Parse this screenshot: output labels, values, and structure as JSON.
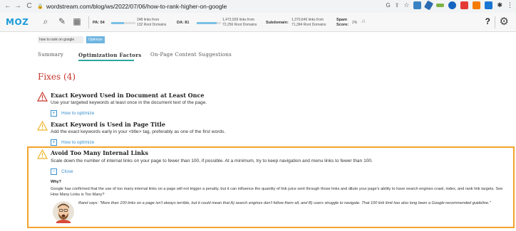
{
  "browser": {
    "url": "wordstream.com/blog/ws/2022/07/06/how-to-rank-higher-on-google",
    "icons": [
      "back-icon",
      "forward-icon",
      "reload-icon",
      "lock-icon",
      "google-icon",
      "share-icon",
      "star-icon"
    ]
  },
  "mozbar": {
    "logo": "MOZ",
    "pa_label": "PA: 54",
    "pa_score": 54,
    "pa_links_line1": "248 links from",
    "pa_links_line2": "132 Root Domains",
    "da_label": "DA: 81",
    "da_score": 81,
    "da_links_line1": "1,472,939 links from",
    "da_links_line2": "72,256 Root Domains",
    "subdomain_label": "Subdomain:",
    "subdomain_line1": "1,370,646 links from",
    "subdomain_line2": "71,394 Root Domains",
    "spam_label": "Spam",
    "spam_label2": "Score:",
    "spam_value": "2%",
    "help": "?",
    "accent": "#1c9bd7"
  },
  "keyword": {
    "value": "how to rank on google",
    "button": "Optimize"
  },
  "tabs": [
    {
      "label": "Summary"
    },
    {
      "label": "Optimization Factors"
    },
    {
      "label": "On-Page Content Suggestions"
    }
  ],
  "fixes": {
    "title": "Fixes (4)",
    "items": [
      {
        "title": "Exact Keyword Used in Document at Least Once",
        "desc": "Use your targeted keywords at least once in the document text of the page.",
        "toggle": "How to optimize",
        "severity": "error"
      },
      {
        "title": "Exact Keyword is Used in Page Title",
        "desc": "Add the exact keywords early in your <title> tag, preferably as one of the first words.",
        "toggle": "How to optimize",
        "severity": "warning"
      },
      {
        "title": "Avoid Too Many Internal Links",
        "desc": "Scale down the number of internal links on your page to fewer than 100, if possible. At a minimum, try to keep navigation and menu links to fewer than 100.",
        "toggle": "Close",
        "severity": "warning",
        "why_label": "Why?",
        "why_text": "Google has confirmed that the use of too many internal links on a page will not trigger a penalty, but it can influence the quantity of link juice sent through those links and dilute your page's ability to have search engines crawl, index, and rank link targets. See How Many Links is Too Many?",
        "quote": "Rand says: \"More than 100 links on a page isn't always terrible, but it could mean that A) search engines don't follow them all, and B) users struggle to navigate. That 100 link limit has also long been a Google-recommended guideline.\""
      }
    ]
  },
  "colors": {
    "error": "#c6352b",
    "warning": "#f0b429",
    "highlight": "#f3a32a",
    "link": "#3a8fcd",
    "tab_active_underline": "#2aa7a0"
  }
}
